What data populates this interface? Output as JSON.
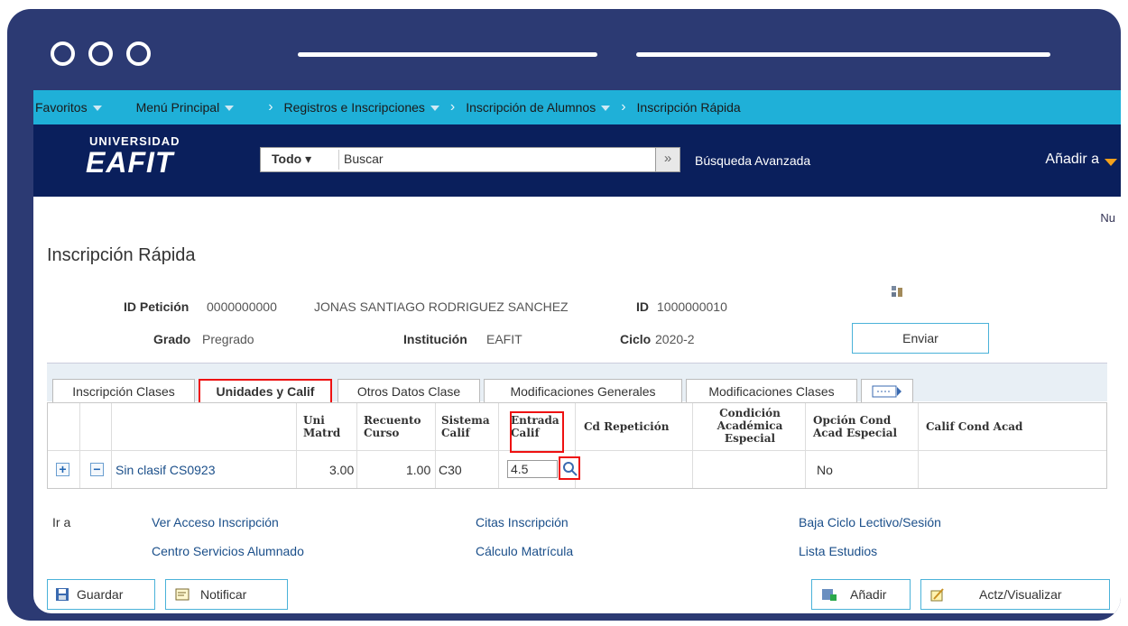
{
  "nav": {
    "favoritos": "Favoritos",
    "menu_principal": "Menú Principal",
    "crumbs": [
      "Registros e Inscripciones",
      "Inscripción de Alumnos",
      "Inscripción Rápida"
    ]
  },
  "header": {
    "logo_top": "UNIVERSIDAD",
    "logo_main": "EAFIT",
    "search_scope": "Todo",
    "search_placeholder": "Buscar",
    "advanced_search": "Búsqueda Avanzada",
    "add_to": "Añadir a",
    "nu": "Nu"
  },
  "page": {
    "title": "Inscripción Rápida",
    "id_peticion_label": "ID Petición",
    "id_peticion_value": "0000000000",
    "student_name": "JONAS SANTIAGO RODRIGUEZ SANCHEZ",
    "id_label": "ID",
    "id_value": "1000000010",
    "grado_label": "Grado",
    "grado_value": "Pregrado",
    "institucion_label": "Institución",
    "institucion_value": "EAFIT",
    "ciclo_label": "Ciclo",
    "ciclo_value": "2020-2",
    "enviar": "Enviar"
  },
  "tabs": [
    "Inscripción Clases",
    "Unidades y Calif",
    "Otros Datos Clase",
    "Modificaciones Generales",
    "Modificaciones Clases"
  ],
  "grid": {
    "headers": {
      "uni_matrd": [
        "Uni",
        "Matrd"
      ],
      "recuento": [
        "Recuento",
        "Curso"
      ],
      "sistema": [
        "Sistema",
        "Calif"
      ],
      "entrada": [
        "Entrada",
        "Calif"
      ],
      "cd_rep": "Cd Repetición",
      "condicion": [
        "Condición",
        "Académica",
        "Especial"
      ],
      "opcion": [
        "Opción Cond",
        "Acad Especial"
      ],
      "calif_cond": "Calif Cond Acad"
    },
    "row": {
      "class": "Sin clasif CS0923",
      "uni": "3.00",
      "recuento": "1.00",
      "sistema": "C30",
      "entrada": "4.5",
      "opcion": "No"
    }
  },
  "links": {
    "ir_a": "Ir a",
    "ver_acceso": "Ver Acceso Inscripción",
    "centro": "Centro Servicios Alumnado",
    "citas": "Citas Inscripción",
    "calculo": "Cálculo Matrícula",
    "baja": "Baja Ciclo Lectivo/Sesión",
    "lista": "Lista Estudios"
  },
  "buttons": {
    "guardar": "Guardar",
    "notificar": "Notificar",
    "anadir": "Añadir",
    "actz": "Actz/Visualizar"
  },
  "colors": {
    "frame": "#2c3a73",
    "nav": "#1fb0d8",
    "header": "#0a1f5c",
    "highlight": "#e11111"
  }
}
